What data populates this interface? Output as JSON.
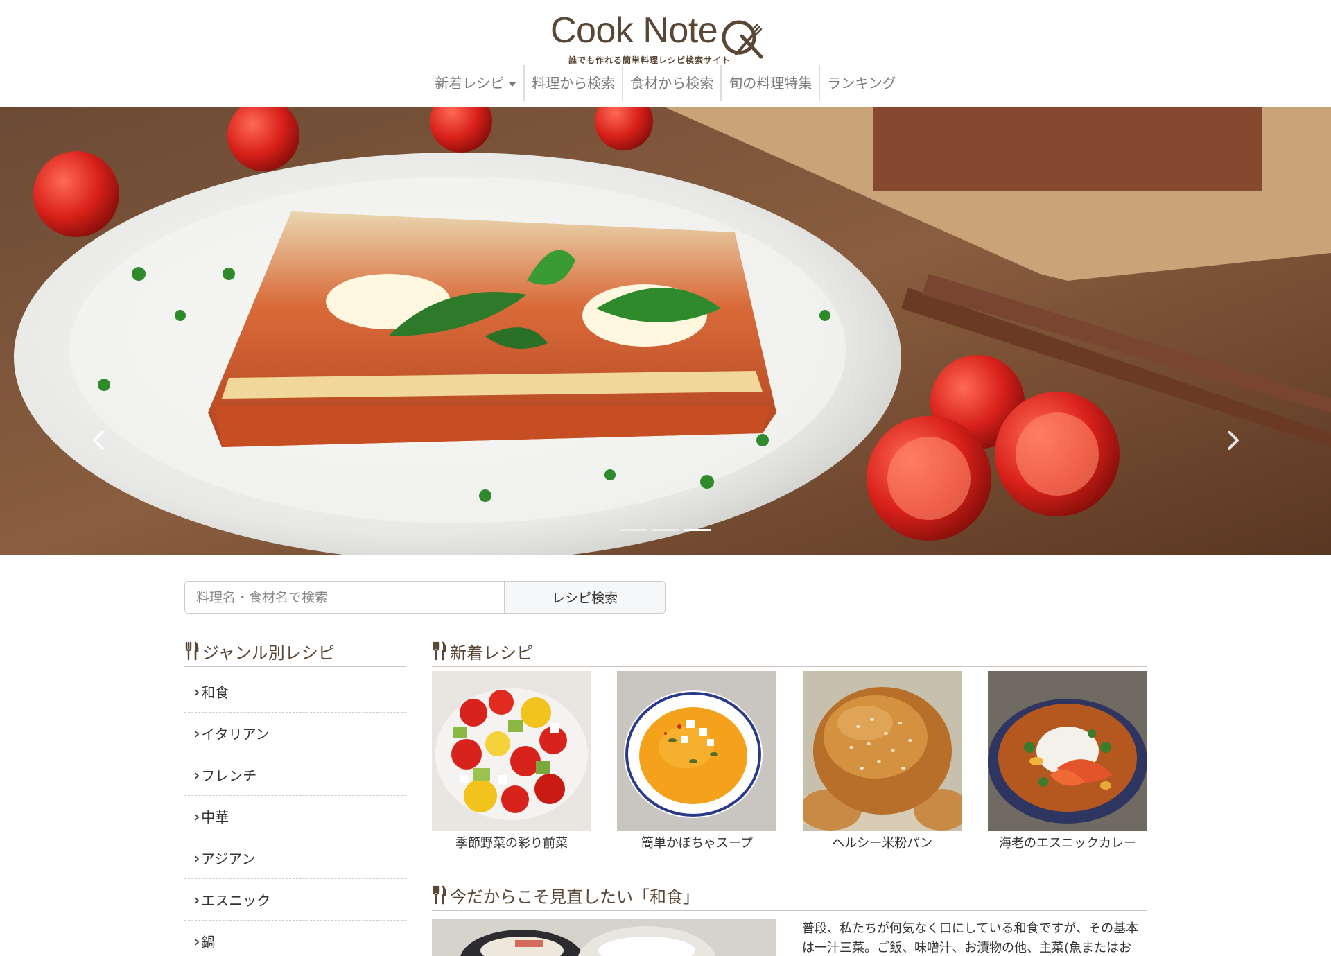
{
  "header": {
    "logo_text": "Cook Note",
    "tagline": "誰でも作れる簡単料理レシピ検索サイト"
  },
  "nav": {
    "items": [
      {
        "label": "新着レシピ",
        "dropdown": true
      },
      {
        "label": "料理から検索"
      },
      {
        "label": "食材から検索"
      },
      {
        "label": "旬の料理特集"
      },
      {
        "label": "ランキング"
      }
    ]
  },
  "hero": {
    "slide_count": 3,
    "active_slide": 3,
    "prev_icon": "chevron-left-icon",
    "next_icon": "chevron-right-icon"
  },
  "search": {
    "placeholder": "料理名・食材名で検索",
    "value": "",
    "button_label": "レシピ検索"
  },
  "genre": {
    "title": "ジャンル別レシピ",
    "items": [
      "和食",
      "イタリアン",
      "フレンチ",
      "中華",
      "アジアン",
      "エスニック",
      "鍋"
    ]
  },
  "new_recipes": {
    "title": "新着レシピ",
    "items": [
      {
        "caption": "季節野菜の彩り前菜"
      },
      {
        "caption": "簡単かぼちゃスープ"
      },
      {
        "caption": "ヘルシー米粉パン"
      },
      {
        "caption": "海老のエスニックカレー"
      }
    ]
  },
  "washoku": {
    "title": "今だからこそ見直したい「和食」",
    "text": "普段、私たちが何気なく口にしている和食ですが、その基本は一汁三菜。ご飯、味噌汁、お漬物の他、主菜(魚またはお肉)、"
  },
  "colors": {
    "brand": "#5a4634",
    "nav_text": "#7a7a7a",
    "rule": "#cfc3bd"
  }
}
